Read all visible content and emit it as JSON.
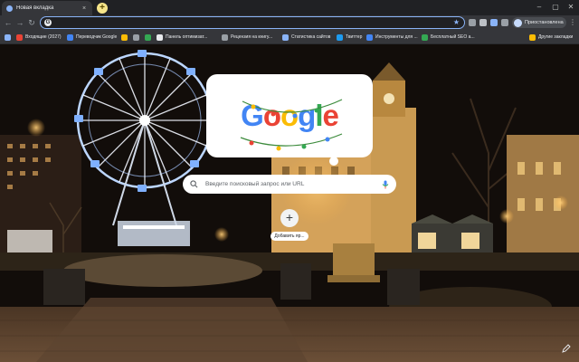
{
  "window": {
    "tab_title": "Новая вкладка",
    "tab_close": "×",
    "new_tab": "+",
    "minimize": "–",
    "maximize": "▢",
    "close": "✕"
  },
  "toolbar": {
    "back": "←",
    "forward": "→",
    "reload": "↻",
    "omnibox_value": "",
    "omnibox_icon": "G",
    "star": "★",
    "profile_name": "Приостановлена",
    "menu": "⋮"
  },
  "bookmarks": [
    {
      "label": "Входящие (2027)",
      "color": "#ea4335"
    },
    {
      "label": "Переводчик Google",
      "color": "#4285f4"
    },
    {
      "label": "",
      "color": "#fbbc05"
    },
    {
      "label": "",
      "color": "#9aa0a6"
    },
    {
      "label": "",
      "color": "#34a853"
    },
    {
      "label": "Панель оптимизат...",
      "color": "#e8eaed"
    },
    {
      "label": "Рецензия на книгу...",
      "color": "#9aa0a6"
    },
    {
      "label": "Статистика сайтов",
      "color": "#8ab4f8"
    },
    {
      "label": "Твиттер",
      "color": "#1d9bf0"
    },
    {
      "label": "Инструменты для ...",
      "color": "#4285f4"
    },
    {
      "label": "Бесплатный SEO а...",
      "color": "#34a853"
    },
    {
      "label": "Другие закладки",
      "color": "#fbbc05"
    }
  ],
  "doodle": {
    "letters": [
      "G",
      "o",
      "o",
      "g",
      "l",
      "e"
    ],
    "colors": [
      "#4285f4",
      "#ea4335",
      "#fbbc05",
      "#4285f4",
      "#34a853",
      "#ea4335"
    ]
  },
  "search": {
    "placeholder": "Введите поисковый запрос или URL"
  },
  "shortcut": {
    "icon": "+",
    "label": "Добавить яр..."
  },
  "colors": {
    "accent": "#8ab4f8",
    "toolbar_bg": "#35363a",
    "frame_bg": "#202124"
  }
}
